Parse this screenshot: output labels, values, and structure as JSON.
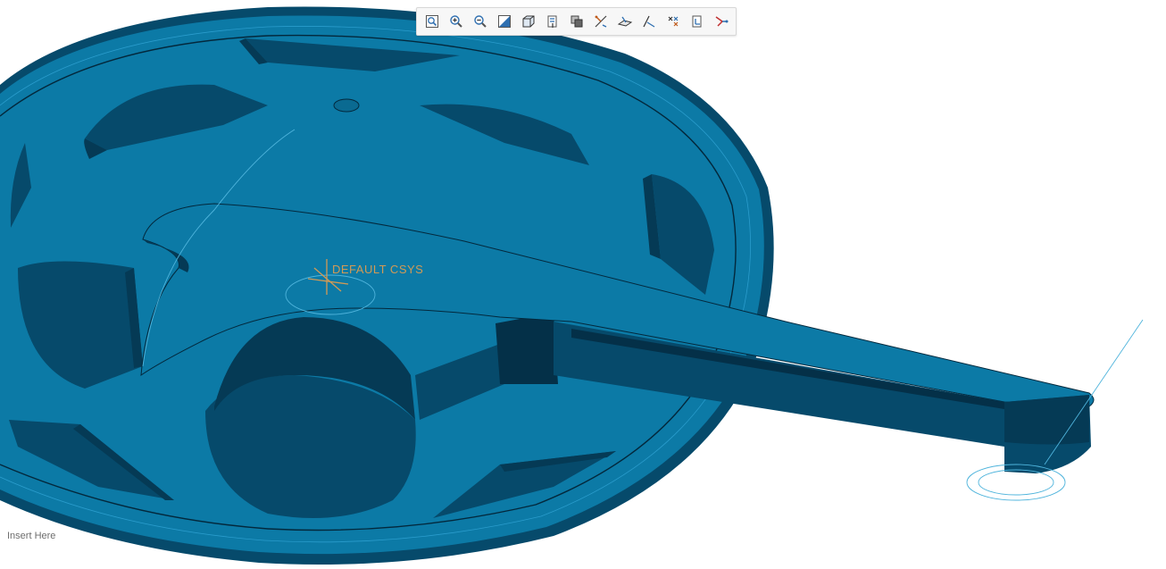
{
  "model": {
    "csys_label": "DEFAULT CSYS",
    "fill_color": "#0c7aa6",
    "dark_color": "#053a55",
    "edge_color": "#03283c",
    "datum_color": "#4fb4dc"
  },
  "toolbar": {
    "buttons": [
      {
        "name": "refit-icon",
        "title": "Refit"
      },
      {
        "name": "zoom-in-icon",
        "title": "Zoom In"
      },
      {
        "name": "zoom-out-icon",
        "title": "Zoom Out"
      },
      {
        "name": "repaint-icon",
        "title": "Repaint"
      },
      {
        "name": "display-style-icon",
        "title": "Display Style"
      },
      {
        "name": "saved-orientations-icon",
        "title": "Saved Orientations"
      },
      {
        "name": "view-manager-icon",
        "title": "View Manager"
      },
      {
        "name": "perspective-icon",
        "title": "Perspective View"
      },
      {
        "name": "plane-display-icon",
        "title": "Plane Display"
      },
      {
        "name": "axis-display-icon",
        "title": "Axis Display"
      },
      {
        "name": "point-display-icon",
        "title": "Point Display"
      },
      {
        "name": "csys-display-icon",
        "title": "Csys Display"
      },
      {
        "name": "annotation-display-icon",
        "title": "Annotation Display"
      }
    ]
  },
  "status": {
    "text": "Insert Here"
  }
}
